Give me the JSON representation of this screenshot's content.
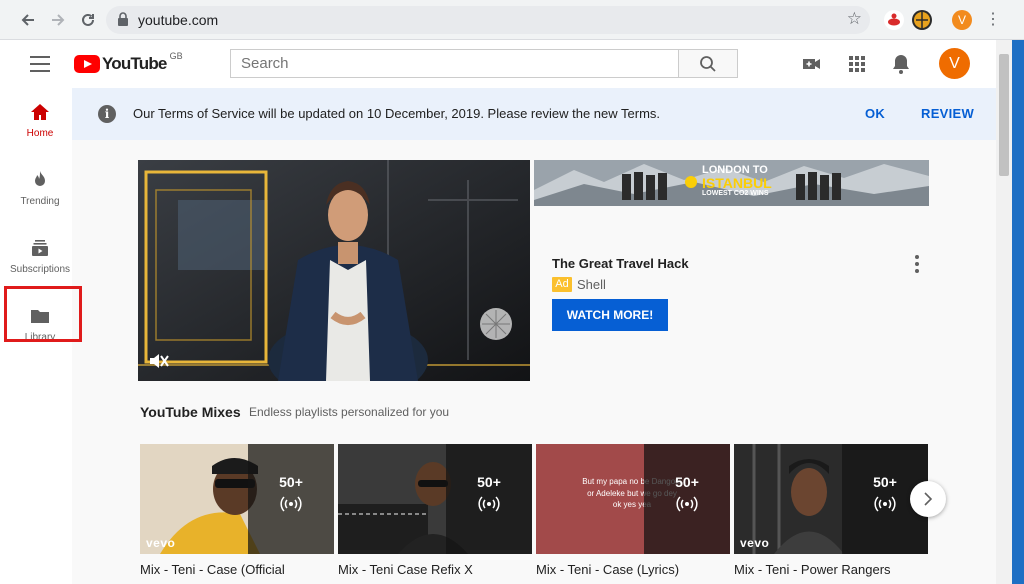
{
  "browser": {
    "url": "youtube.com",
    "profile_initial": "V"
  },
  "masthead": {
    "logo_text": "YouTube",
    "region": "GB",
    "search_placeholder": "Search",
    "avatar_initial": "V"
  },
  "guide": {
    "items": [
      {
        "label": "Home",
        "icon": "home-icon",
        "active": true
      },
      {
        "label": "Trending",
        "icon": "flame-icon",
        "active": false
      },
      {
        "label": "Subscriptions",
        "icon": "subscriptions-icon",
        "active": false
      },
      {
        "label": "Library",
        "icon": "folder-icon",
        "active": false
      }
    ]
  },
  "banner": {
    "message": "Our Terms of Service will be updated on 10 December, 2019. Please review the new Terms.",
    "ok_label": "OK",
    "review_label": "REVIEW"
  },
  "ad": {
    "banner_line1": "LONDON TO",
    "banner_line2": "ISTANBUL",
    "banner_line3": "LOWEST CO2 WINS",
    "title": "The Great Travel Hack",
    "badge": "Ad",
    "advertiser": "Shell",
    "cta_label": "WATCH MORE!"
  },
  "mixes": {
    "title": "YouTube Mixes",
    "subtitle": "Endless playlists personalized for you",
    "items": [
      {
        "title": "Mix - Teni - Case (Official",
        "count": "50+",
        "vevo": "vevo",
        "caption": ""
      },
      {
        "title": "Mix - Teni Case Refix X",
        "count": "50+",
        "vevo": "",
        "caption": ""
      },
      {
        "title": "Mix - Teni - Case (Lyrics)",
        "count": "50+",
        "vevo": "",
        "caption": "But my papa no be Dangote or Adeleke but we go dey ok yes yea"
      },
      {
        "title": "Mix - Teni - Power Rangers",
        "count": "50+",
        "vevo": "vevo",
        "caption": ""
      }
    ]
  },
  "colors": {
    "brand_red": "#ff0000",
    "link_blue": "#065fd4",
    "highlight_red": "#e01b1b",
    "avatar_orange": "#ef6c00"
  }
}
